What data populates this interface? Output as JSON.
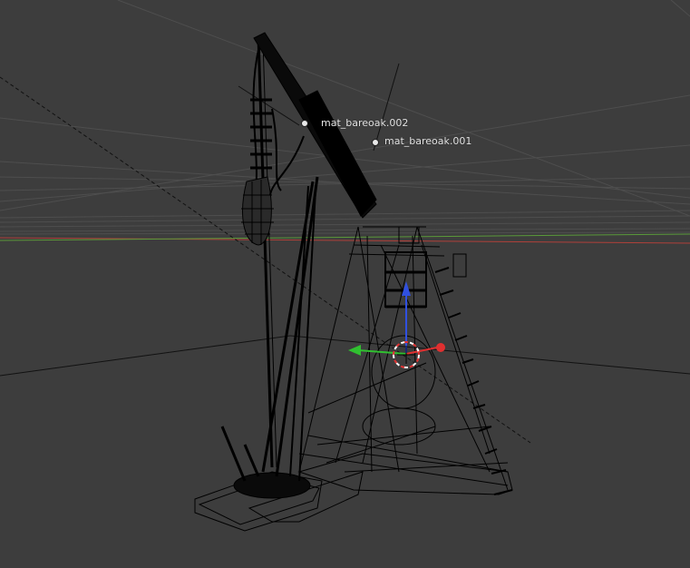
{
  "viewport": {
    "mode": "Wireframe",
    "background_color": "#3d3d3d",
    "grid_color": "#4f4f4f",
    "axis_x_color": "#b0403a",
    "axis_y_color": "#5a9a3a",
    "wire_color": "#000000"
  },
  "objects": [
    {
      "label": "mat_bareoak.002"
    },
    {
      "label": "mat_bareoak.001"
    }
  ],
  "gizmo": {
    "x_color": "#e03030",
    "y_color": "#30c030",
    "z_color": "#3050e0",
    "center_icon": "3d-cursor-icon"
  }
}
